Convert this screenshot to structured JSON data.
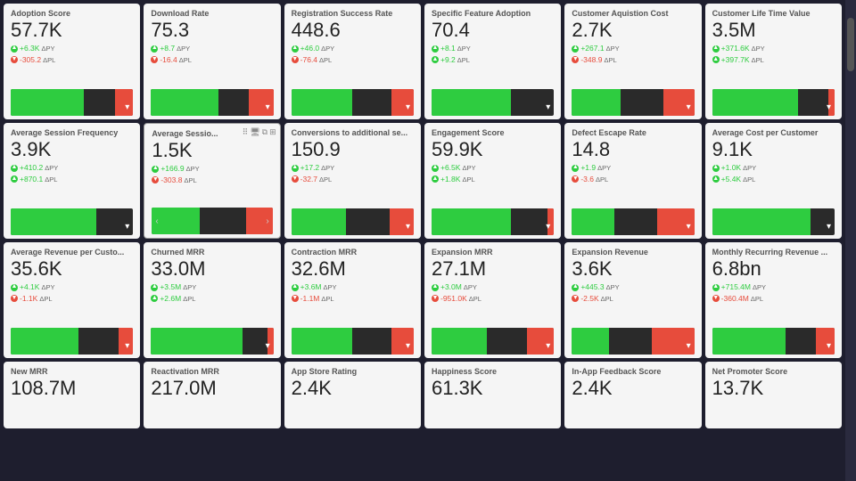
{
  "colors": {
    "green": "#2ecc40",
    "red": "#e74c3c",
    "darkBg": "#2a2a2a",
    "cardBg": "#f5f5f5"
  },
  "rows": [
    {
      "cards": [
        {
          "id": "adoption-score",
          "title": "Adoption Score",
          "value": "57.7K",
          "deltas": [
            {
              "sign": "+",
              "val": "+6.3K",
              "label": "ΔPY",
              "type": "positive"
            },
            {
              "sign": "-",
              "val": "-305.2",
              "label": "ΔPL",
              "type": "negative"
            }
          ],
          "spark": {
            "greenWidth": "60%",
            "redWidth": "15%"
          }
        },
        {
          "id": "download-rate",
          "title": "Download Rate",
          "value": "75.3",
          "deltas": [
            {
              "sign": "+",
              "val": "+8.7",
              "label": "ΔPY",
              "type": "positive"
            },
            {
              "sign": "-",
              "val": "-16.4",
              "label": "ΔPL",
              "type": "negative"
            }
          ],
          "spark": {
            "greenWidth": "55%",
            "redWidth": "20%"
          }
        },
        {
          "id": "registration-success-rate",
          "title": "Registration Success Rate",
          "value": "448.6",
          "deltas": [
            {
              "sign": "+",
              "val": "+46.0",
              "label": "ΔPY",
              "type": "positive"
            },
            {
              "sign": "-",
              "val": "-76.4",
              "label": "ΔPL",
              "type": "negative"
            }
          ],
          "spark": {
            "greenWidth": "50%",
            "redWidth": "18%"
          }
        },
        {
          "id": "specific-feature-adoption",
          "title": "Specific Feature Adoption",
          "value": "70.4",
          "deltas": [
            {
              "sign": "+",
              "val": "+8.1",
              "label": "ΔPY",
              "type": "positive"
            },
            {
              "sign": "+",
              "val": "+9.2",
              "label": "ΔPL",
              "type": "positive"
            }
          ],
          "spark": {
            "greenWidth": "65%",
            "redWidth": "0%"
          }
        },
        {
          "id": "customer-acquisition-cost",
          "title": "Customer Aquistion Cost",
          "value": "2.7K",
          "deltas": [
            {
              "sign": "+",
              "val": "+267.1",
              "label": "ΔPY",
              "type": "positive"
            },
            {
              "sign": "-",
              "val": "-348.9",
              "label": "ΔPL",
              "type": "negative"
            }
          ],
          "spark": {
            "greenWidth": "40%",
            "redWidth": "25%"
          }
        },
        {
          "id": "customer-lifetime-value",
          "title": "Customer Life Time Value",
          "value": "3.5M",
          "deltas": [
            {
              "sign": "+",
              "val": "+371.6K",
              "label": "ΔPY",
              "type": "positive"
            },
            {
              "sign": "+",
              "val": "+397.7K",
              "label": "ΔPL",
              "type": "positive"
            }
          ],
          "spark": {
            "greenWidth": "70%",
            "redWidth": "5%"
          }
        }
      ]
    },
    {
      "cards": [
        {
          "id": "average-session-frequency",
          "title": "Average Session Frequency",
          "value": "3.9K",
          "deltas": [
            {
              "sign": "+",
              "val": "+410.2",
              "label": "ΔPY",
              "type": "positive"
            },
            {
              "sign": "+",
              "val": "+870.1",
              "label": "ΔPL",
              "type": "positive"
            }
          ],
          "spark": {
            "greenWidth": "70%",
            "redWidth": "0%"
          },
          "selected": false
        },
        {
          "id": "average-session-2",
          "title": "Average Sessio...",
          "value": "1.5K",
          "deltas": [
            {
              "sign": "+",
              "val": "+166.9",
              "label": "ΔPY",
              "type": "positive"
            },
            {
              "sign": "-",
              "val": "-303.8",
              "label": "ΔPL",
              "type": "negative"
            }
          ],
          "spark": {
            "greenWidth": "40%",
            "redWidth": "22%"
          },
          "selected": true,
          "hasTools": true
        },
        {
          "id": "conversions-additional",
          "title": "Conversions to additional se...",
          "value": "150.9",
          "deltas": [
            {
              "sign": "+",
              "val": "+17.2",
              "label": "ΔPY",
              "type": "positive"
            },
            {
              "sign": "-",
              "val": "-32.7",
              "label": "ΔPL",
              "type": "negative"
            }
          ],
          "spark": {
            "greenWidth": "45%",
            "redWidth": "20%"
          }
        },
        {
          "id": "engagement-score",
          "title": "Engagement Score",
          "value": "59.9K",
          "deltas": [
            {
              "sign": "+",
              "val": "+6.5K",
              "label": "ΔPY",
              "type": "positive"
            },
            {
              "sign": "+",
              "val": "+1.8K",
              "label": "ΔPL",
              "type": "positive"
            }
          ],
          "spark": {
            "greenWidth": "65%",
            "redWidth": "5%"
          }
        },
        {
          "id": "defect-escape-rate",
          "title": "Defect Escape Rate",
          "value": "14.8",
          "deltas": [
            {
              "sign": "+",
              "val": "+1.9",
              "label": "ΔPY",
              "type": "positive"
            },
            {
              "sign": "-",
              "val": "-3.6",
              "label": "ΔPL",
              "type": "negative"
            }
          ],
          "spark": {
            "greenWidth": "35%",
            "redWidth": "30%"
          }
        },
        {
          "id": "average-cost-per-customer",
          "title": "Average Cost per Customer",
          "value": "9.1K",
          "deltas": [
            {
              "sign": "+",
              "val": "+1.0K",
              "label": "ΔPY",
              "type": "positive"
            },
            {
              "sign": "+",
              "val": "+5.4K",
              "label": "ΔPL",
              "type": "positive"
            }
          ],
          "spark": {
            "greenWidth": "80%",
            "redWidth": "0%"
          }
        }
      ]
    },
    {
      "cards": [
        {
          "id": "average-revenue-per-customer",
          "title": "Average Revenue per Custo...",
          "value": "35.6K",
          "deltas": [
            {
              "sign": "+",
              "val": "+4.1K",
              "label": "ΔPY",
              "type": "positive"
            },
            {
              "sign": "-",
              "val": "-1.1K",
              "label": "ΔPL",
              "type": "negative"
            }
          ],
          "spark": {
            "greenWidth": "55%",
            "redWidth": "12%"
          }
        },
        {
          "id": "churned-mrr",
          "title": "Churned MRR",
          "value": "33.0M",
          "deltas": [
            {
              "sign": "+",
              "val": "+3.5M",
              "label": "ΔPY",
              "type": "positive"
            },
            {
              "sign": "+",
              "val": "+2.6M",
              "label": "ΔPL",
              "type": "positive"
            }
          ],
          "spark": {
            "greenWidth": "75%",
            "redWidth": "5%"
          }
        },
        {
          "id": "contraction-mrr",
          "title": "Contraction MRR",
          "value": "32.6M",
          "deltas": [
            {
              "sign": "+",
              "val": "+3.6M",
              "label": "ΔPY",
              "type": "positive"
            },
            {
              "sign": "-",
              "val": "-1.1M",
              "label": "ΔPL",
              "type": "negative"
            }
          ],
          "spark": {
            "greenWidth": "50%",
            "redWidth": "18%"
          }
        },
        {
          "id": "expansion-mrr",
          "title": "Expansion MRR",
          "value": "27.1M",
          "deltas": [
            {
              "sign": "+",
              "val": "+3.0M",
              "label": "ΔPY",
              "type": "positive"
            },
            {
              "sign": "-",
              "val": "-951.0K",
              "label": "ΔPL",
              "type": "negative"
            }
          ],
          "spark": {
            "greenWidth": "45%",
            "redWidth": "22%"
          }
        },
        {
          "id": "expansion-revenue",
          "title": "Expansion Revenue",
          "value": "3.6K",
          "deltas": [
            {
              "sign": "+",
              "val": "+445.3",
              "label": "ΔPY",
              "type": "positive"
            },
            {
              "sign": "-",
              "val": "-2.5K",
              "label": "ΔPL",
              "type": "negative"
            }
          ],
          "spark": {
            "greenWidth": "30%",
            "redWidth": "35%"
          }
        },
        {
          "id": "monthly-recurring-revenue",
          "title": "Monthly Recurring Revenue ...",
          "value": "6.8bn",
          "deltas": [
            {
              "sign": "+",
              "val": "+715.4M",
              "label": "ΔPY",
              "type": "positive"
            },
            {
              "sign": "-",
              "val": "-360.4M",
              "label": "ΔPL",
              "type": "negative"
            }
          ],
          "spark": {
            "greenWidth": "60%",
            "redWidth": "15%"
          }
        }
      ]
    },
    {
      "isBottom": true,
      "cards": [
        {
          "id": "new-mrr",
          "title": "New MRR",
          "value": "108.7M",
          "deltas": []
        },
        {
          "id": "reactivation-mrr",
          "title": "Reactivation MRR",
          "value": "217.0M",
          "deltas": []
        },
        {
          "id": "app-store-rating",
          "title": "App Store Rating",
          "value": "2.4K",
          "deltas": []
        },
        {
          "id": "happiness-score",
          "title": "Happiness Score",
          "value": "61.3K",
          "deltas": []
        },
        {
          "id": "in-app-feedback-score",
          "title": "In-App Feedback Score",
          "value": "2.4K",
          "deltas": []
        },
        {
          "id": "net-promoter-score",
          "title": "Net Promoter Score",
          "value": "13.7K",
          "deltas": []
        }
      ]
    }
  ]
}
